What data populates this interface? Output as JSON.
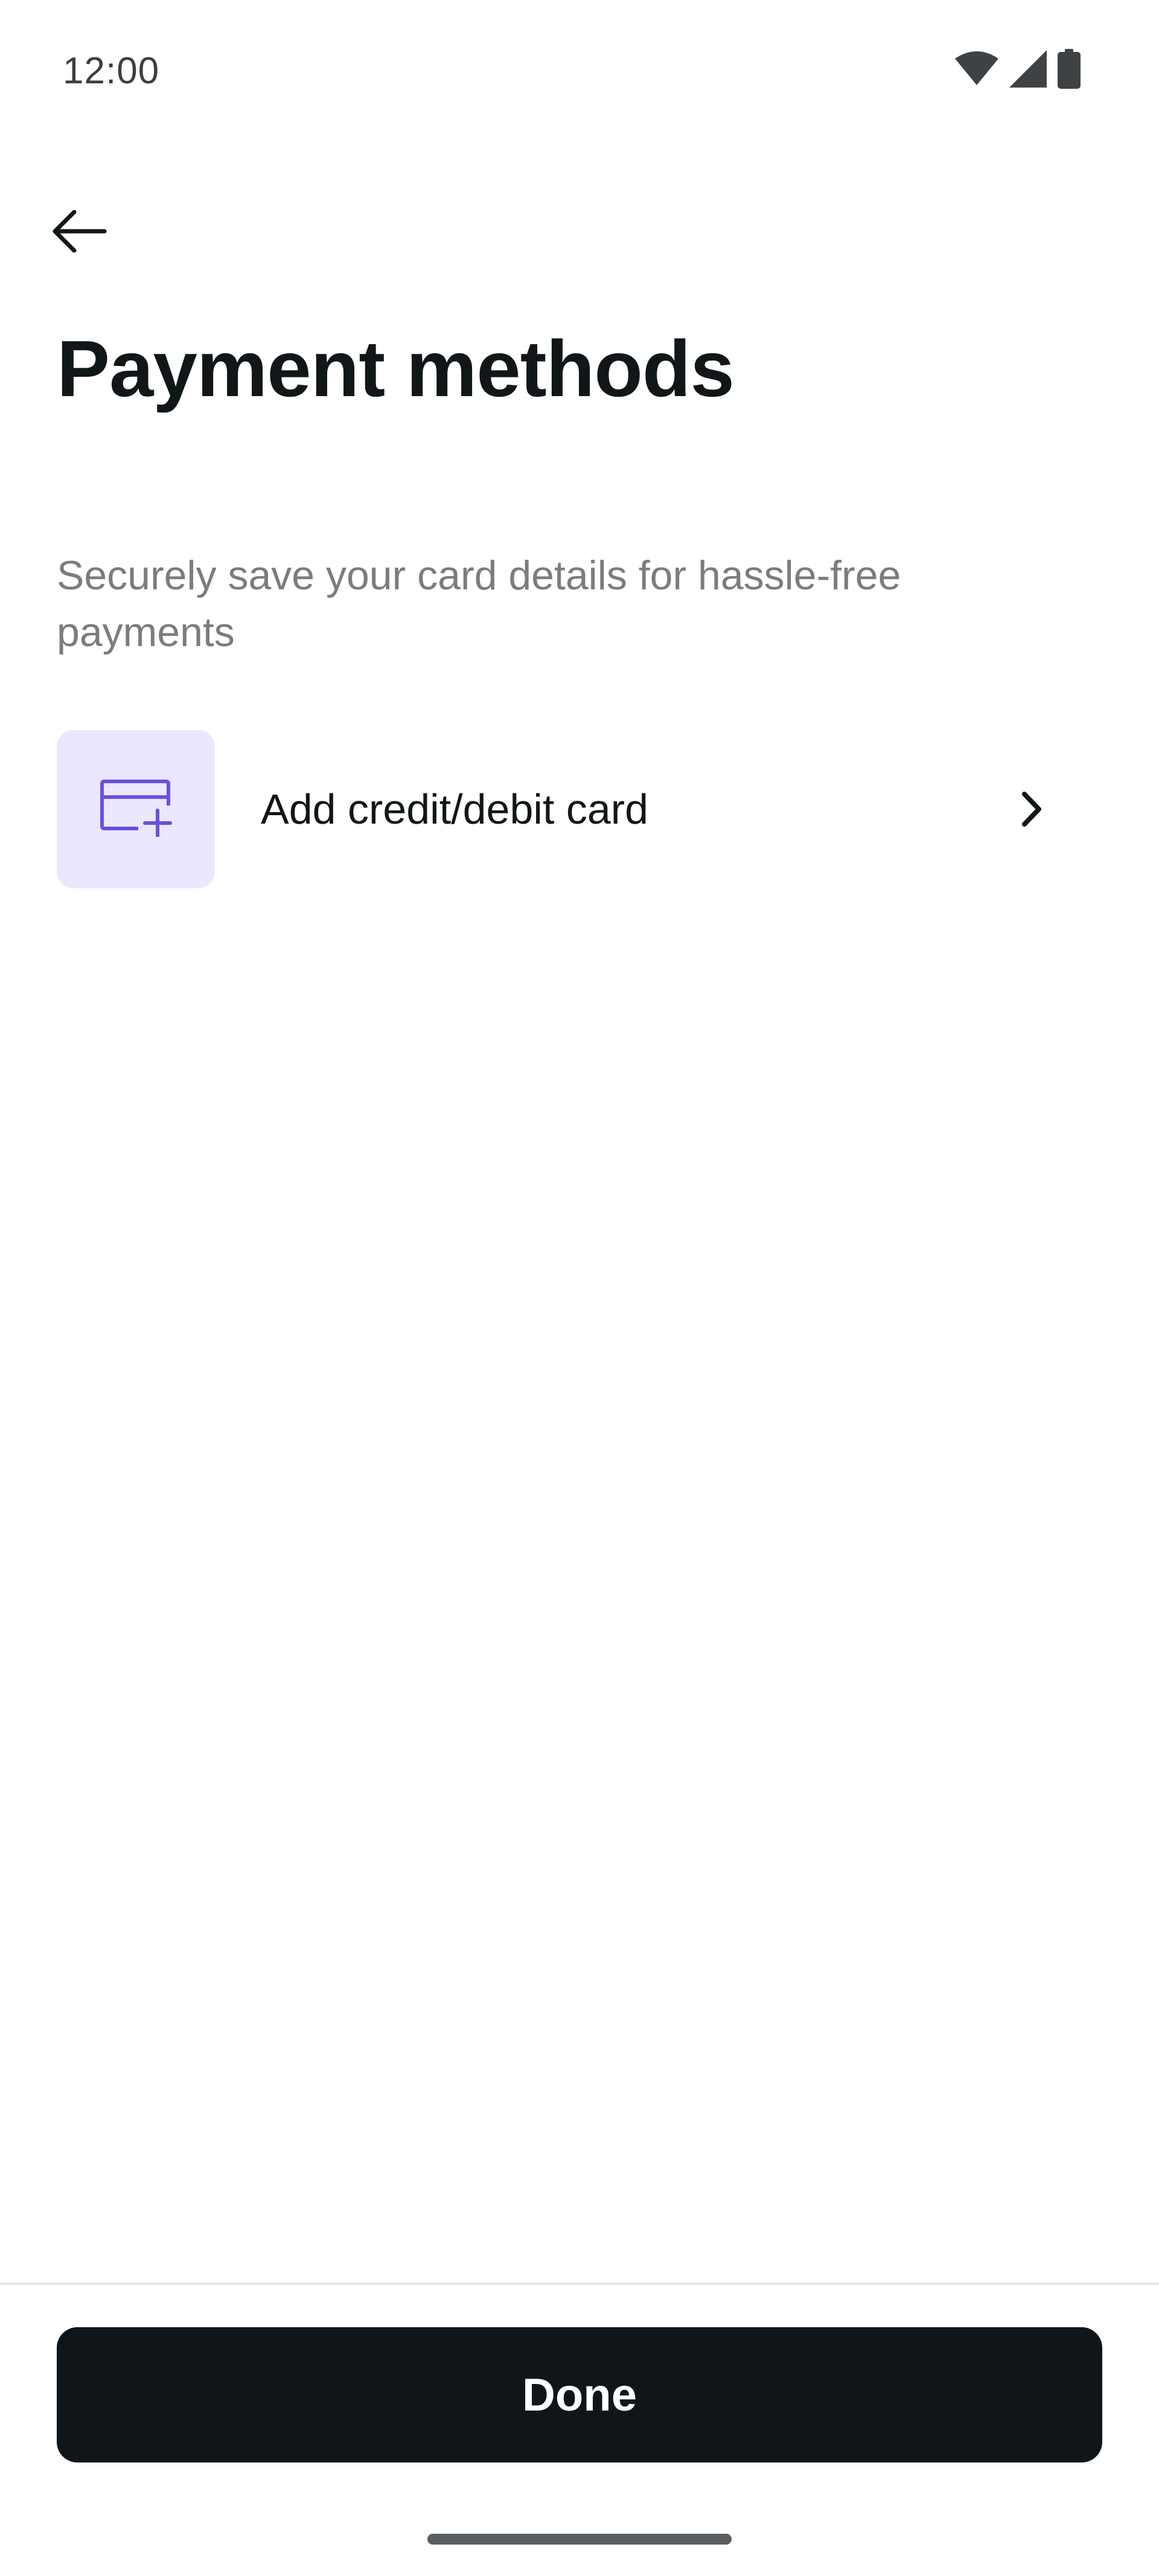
{
  "status_bar": {
    "time": "12:00",
    "icons": [
      "wifi-icon",
      "cellular-signal-icon",
      "battery-icon"
    ]
  },
  "header": {
    "back_icon": "arrow-left-icon",
    "title": "Payment methods"
  },
  "main": {
    "description": "Securely save your card details for hassle-free payments",
    "add_card": {
      "label": "Add credit/debit card",
      "icon": "add-card-icon",
      "chevron": "chevron-right-icon"
    }
  },
  "footer": {
    "done_label": "Done"
  },
  "colors": {
    "accent": "#6a4fe0",
    "icon_box_bg": "#e9e8ff",
    "primary_button_bg": "#0f1518",
    "text_primary": "#111618",
    "text_secondary": "#7a7d80"
  }
}
